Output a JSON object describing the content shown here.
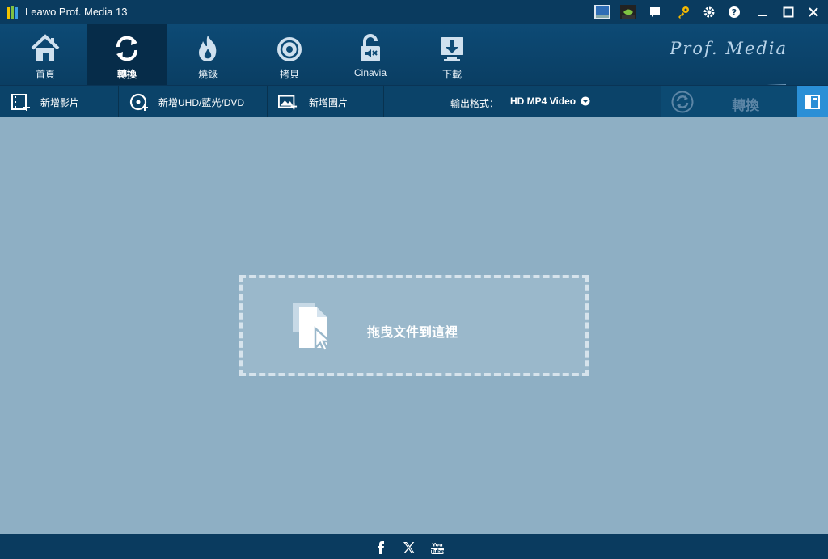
{
  "window": {
    "title": "Leawo Prof. Media 13"
  },
  "nav": {
    "items": [
      {
        "id": "home",
        "label": "首頁"
      },
      {
        "id": "convert",
        "label": "轉換"
      },
      {
        "id": "burn",
        "label": "燒錄"
      },
      {
        "id": "copy",
        "label": "拷貝"
      },
      {
        "id": "cinavia",
        "label": "Cinavia"
      },
      {
        "id": "download",
        "label": "下載"
      }
    ],
    "active": "convert",
    "brand": "Prof. Media"
  },
  "toolbar": {
    "add_video": "新增影片",
    "add_disc": "新增UHD/藍光/DVD",
    "add_photo": "新增圖片",
    "output_format_label": "輸出格式：",
    "output_format_value": "HD MP4 Video",
    "convert_label": "轉換"
  },
  "main": {
    "drop_text": "拖曳文件到這裡"
  },
  "colors": {
    "accent": "#2a8fd6",
    "titlebar": "#0a3b5f",
    "main_bg": "#8eafc4"
  }
}
